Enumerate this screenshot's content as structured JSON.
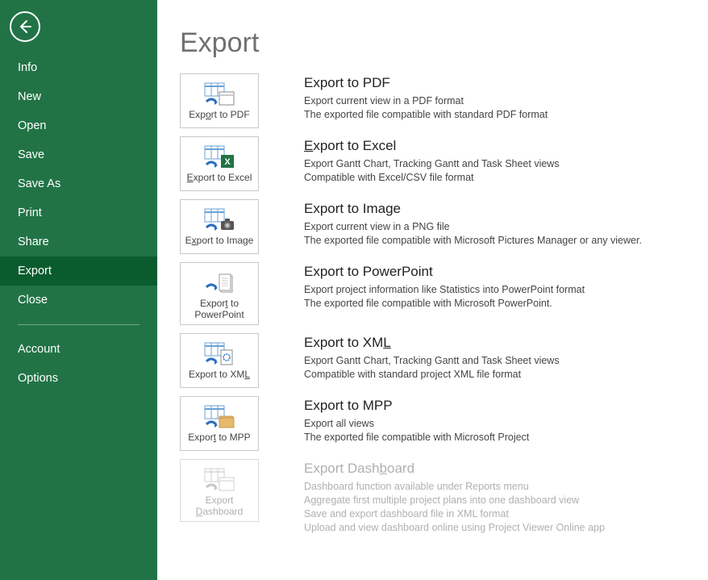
{
  "sidebar": {
    "items": [
      {
        "label": "Info"
      },
      {
        "label": "New"
      },
      {
        "label": "Open"
      },
      {
        "label": "Save"
      },
      {
        "label": "Save As"
      },
      {
        "label": "Print"
      },
      {
        "label": "Share"
      },
      {
        "label": "Export"
      },
      {
        "label": "Close"
      }
    ],
    "footer": [
      {
        "label": "Account"
      },
      {
        "label": "Options"
      }
    ]
  },
  "page": {
    "title": "Export"
  },
  "exports": [
    {
      "tile_label": "Export to PDF",
      "title": "Export to PDF",
      "lines": [
        "Export current view in a PDF format",
        "The exported file compatible with standard PDF format"
      ]
    },
    {
      "tile_label": "Export to Excel",
      "title": "Export to Excel",
      "lines": [
        "Export Gantt Chart, Tracking Gantt and Task Sheet views",
        "Compatible with Excel/CSV file format"
      ]
    },
    {
      "tile_label": "Export to Image",
      "title": "Export to Image",
      "lines": [
        "Export current view in a PNG file",
        "The exported file compatible with Microsoft Pictures Manager or any viewer."
      ]
    },
    {
      "tile_label": "Export to PowerPoint",
      "title": "Export to PowerPoint",
      "lines": [
        "Export project information like Statistics into PowerPoint format",
        "The exported file compatible with Microsoft PowerPoint."
      ]
    },
    {
      "tile_label": "Export to XML",
      "title": "Export to XML",
      "lines": [
        "Export Gantt Chart, Tracking Gantt and Task Sheet views",
        "Compatible with standard project XML file format"
      ]
    },
    {
      "tile_label": "Export to MPP",
      "title": "Export to MPP",
      "lines": [
        "Export all views",
        "The exported file compatible with Microsoft Project"
      ]
    },
    {
      "tile_label": "Export Dashboard",
      "title": "Export Dashboard",
      "lines": [
        "Dashboard function available under Reports menu",
        "Aggregate first multiple project plans into one dashboard view",
        "Save and export dashboard file in XML format",
        "Upload and view dashboard online using Project Viewer Online app"
      ]
    }
  ]
}
